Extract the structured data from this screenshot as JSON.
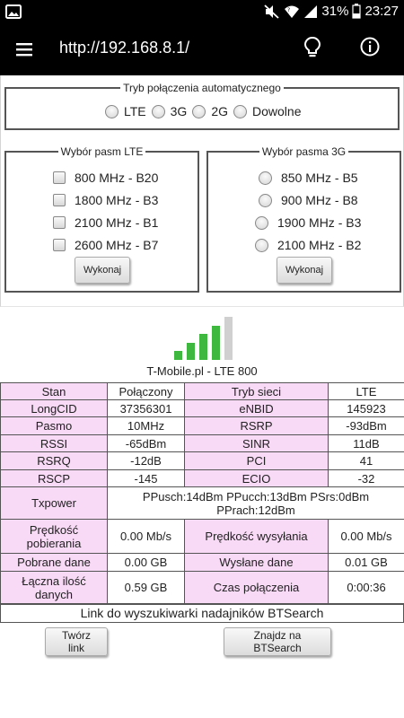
{
  "status_bar": {
    "battery_percent": "31%",
    "time": "23:27",
    "icons": [
      "image-icon",
      "mute-icon",
      "wifi-icon",
      "signal-icon",
      "battery-icon"
    ]
  },
  "app_bar": {
    "url": "http://192.168.8.1/",
    "icons": [
      "menu-icon",
      "lightbulb-icon",
      "info-icon"
    ]
  },
  "mode": {
    "legend": "Tryb połączenia automatycznego",
    "options": [
      "LTE",
      "3G",
      "2G",
      "Dowolne"
    ]
  },
  "lte_bands": {
    "legend": "Wybór pasm LTE",
    "options": [
      "800 MHz - B20",
      "1800 MHz - B3",
      "2100 MHz - B1",
      "2600 MHz - B7"
    ],
    "button": "Wykonaj"
  },
  "bands_3g": {
    "legend": "Wybór pasma 3G",
    "options": [
      "850 MHz - B5",
      "900 MHz - B8",
      "1900 MHz - B3",
      "2100 MHz - B2"
    ],
    "button": "Wykonaj"
  },
  "signal": {
    "level_bars_active": 4,
    "level_bars_total": 5,
    "active_color": "#3fb83f",
    "inactive_color": "#d0d0d0"
  },
  "operator": "T-Mobile.pl - LTE 800",
  "table": {
    "rows": [
      [
        "Stan",
        "Połączony",
        "Tryb sieci",
        "LTE"
      ],
      [
        "LongCID",
        "37356301",
        "eNBID",
        "145923"
      ],
      [
        "Pasmo",
        "10MHz",
        "RSRP",
        "-93dBm"
      ],
      [
        "RSSI",
        "-65dBm",
        "SINR",
        "11dB"
      ],
      [
        "RSRQ",
        "-12dB",
        "PCI",
        "41"
      ],
      [
        "RSCP",
        "-145",
        "ECIO",
        "-32"
      ]
    ],
    "txpower_label": "Txpower",
    "txpower_value": "PPusch:14dBm PPucch:13dBm PSrs:0dBm PPrach:12dBm",
    "speed_row": [
      "Prędkość pobierania",
      "0.00 Mb/s",
      "Prędkość wysyłania",
      "0.00 Mb/s"
    ],
    "data_row": [
      "Pobrane dane",
      "0.00 GB",
      "Wysłane dane",
      "0.01 GB"
    ],
    "total_row": [
      "Łączna ilość danych",
      "0.59 GB",
      "Czas połączenia",
      "0:00:36"
    ]
  },
  "link_text": "Link do wyszukiwarki nadajników BTSearch",
  "buttons": {
    "create_link": "Twórz link",
    "find_btsearch": "Znajdz na BTSearch"
  },
  "colors": {
    "header_cell": "#f8d9f6",
    "border": "#555555"
  }
}
